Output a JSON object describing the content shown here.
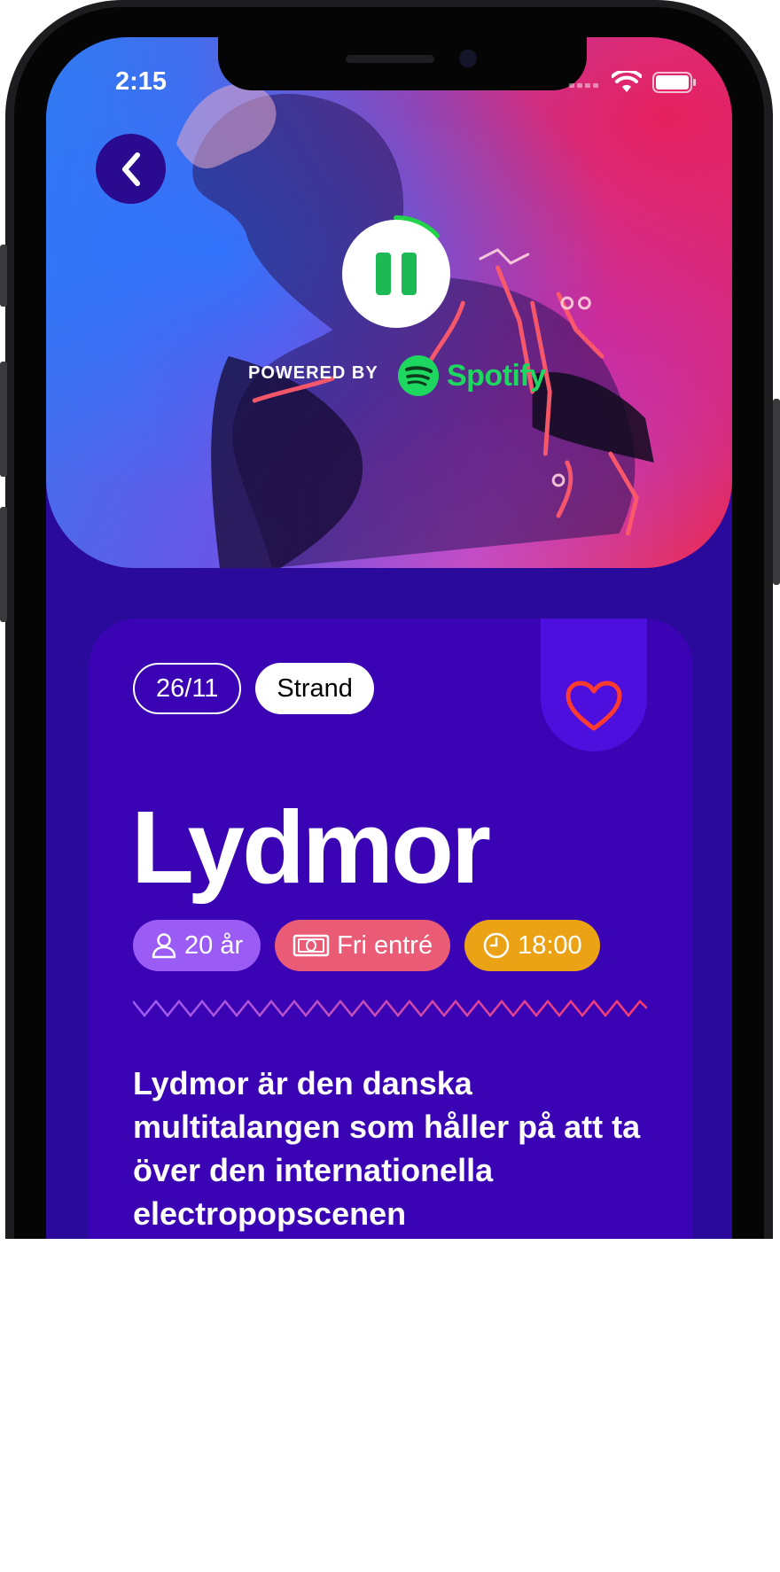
{
  "status": {
    "time": "2:15"
  },
  "player": {
    "powered_by": "POWERED BY",
    "provider": "Spotify"
  },
  "event": {
    "date": "26/11",
    "venue": "Strand",
    "artist": "Lydmor",
    "age": "20 år",
    "price": "Fri entré",
    "time": "18:00",
    "description": "Lydmor är den danska multitalangen som håller på att ta över den internationella electropopscenen"
  },
  "colors": {
    "background": "#2a0a9a",
    "card": "#3a04b4",
    "favorite": "#ff3b30",
    "spotify": "#1ed760",
    "tag_age": "#9b5bf5",
    "tag_price": "#ea5b76",
    "tag_time": "#eba215"
  },
  "icons": [
    "back-chevron-icon",
    "pause-icon",
    "spotify-logo-icon",
    "heart-icon",
    "person-icon",
    "cash-icon",
    "clock-icon",
    "wifi-icon",
    "battery-icon",
    "signal-icon"
  ]
}
